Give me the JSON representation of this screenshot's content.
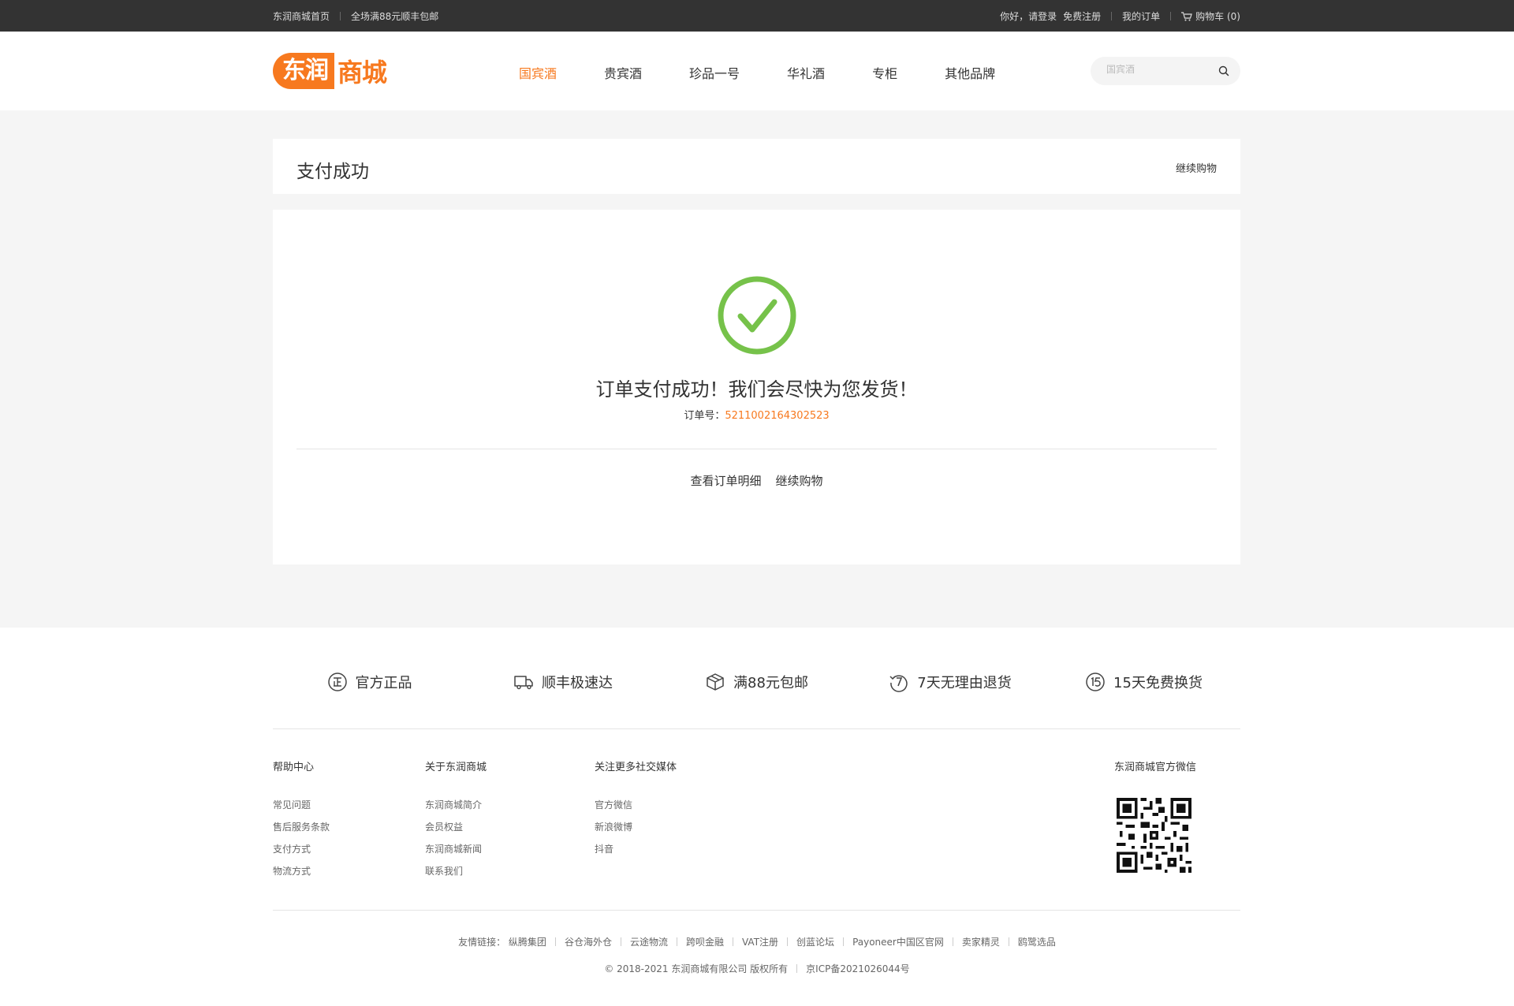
{
  "topbar": {
    "home": "东润商城首页",
    "promo": "全场满88元顺丰包邮",
    "login": "你好，请登录",
    "register": "免费注册",
    "orders": "我的订单",
    "cart": "购物车 (0)"
  },
  "header": {
    "logo_part1": "东润",
    "logo_part2": "商城",
    "nav": [
      "国宾酒",
      "贵宾酒",
      "珍品一号",
      "华礼酒",
      "专柜",
      "其他品牌"
    ],
    "active_nav": "国宾酒",
    "search_placeholder": "国宾酒"
  },
  "page": {
    "title": "支付成功",
    "continue_top": "继续购物",
    "message": "订单支付成功！我们会尽快为您发货！",
    "order_label": "订单号：",
    "order_no": "5211002164302523",
    "view_order": "查看订单明细",
    "continue": "继续购物"
  },
  "features": [
    {
      "icon": "official-icon",
      "label": "官方正品"
    },
    {
      "icon": "truck-icon",
      "label": "顺丰极速达"
    },
    {
      "icon": "box-icon",
      "label": "满88元包邮"
    },
    {
      "icon": "return-7-icon",
      "label": "7天无理由退货"
    },
    {
      "icon": "exchange-15-icon",
      "label": "15天免费换货"
    }
  ],
  "footer": {
    "help": {
      "title": "帮助中心",
      "items": [
        "常见问题",
        "售后服务条款",
        "支付方式",
        "物流方式"
      ]
    },
    "about": {
      "title": "关于东润商城",
      "items": [
        "东润商城简介",
        "会员权益",
        "东润商城新闻",
        "联系我们"
      ]
    },
    "social": {
      "title": "关注更多社交媒体",
      "items": [
        "官方微信",
        "新浪微博",
        "抖音"
      ]
    },
    "wechat_title": "东润商城官方微信",
    "friends_label": "友情链接：",
    "friends": [
      "纵腾集团",
      "谷仓海外仓",
      "云途物流",
      "跨呗金融",
      "VAT注册",
      "创蓝论坛",
      "Payoneer中国区官网",
      "卖家精灵",
      "鸥鹭选品"
    ],
    "copyright": "© 2018-2021 东润商城有限公司 版权所有",
    "icp": "京ICP备2021026044号"
  },
  "colors": {
    "accent": "#f7791f",
    "success": "#76c24a",
    "topbar": "#333333",
    "page_bg": "#f5f5f5"
  }
}
